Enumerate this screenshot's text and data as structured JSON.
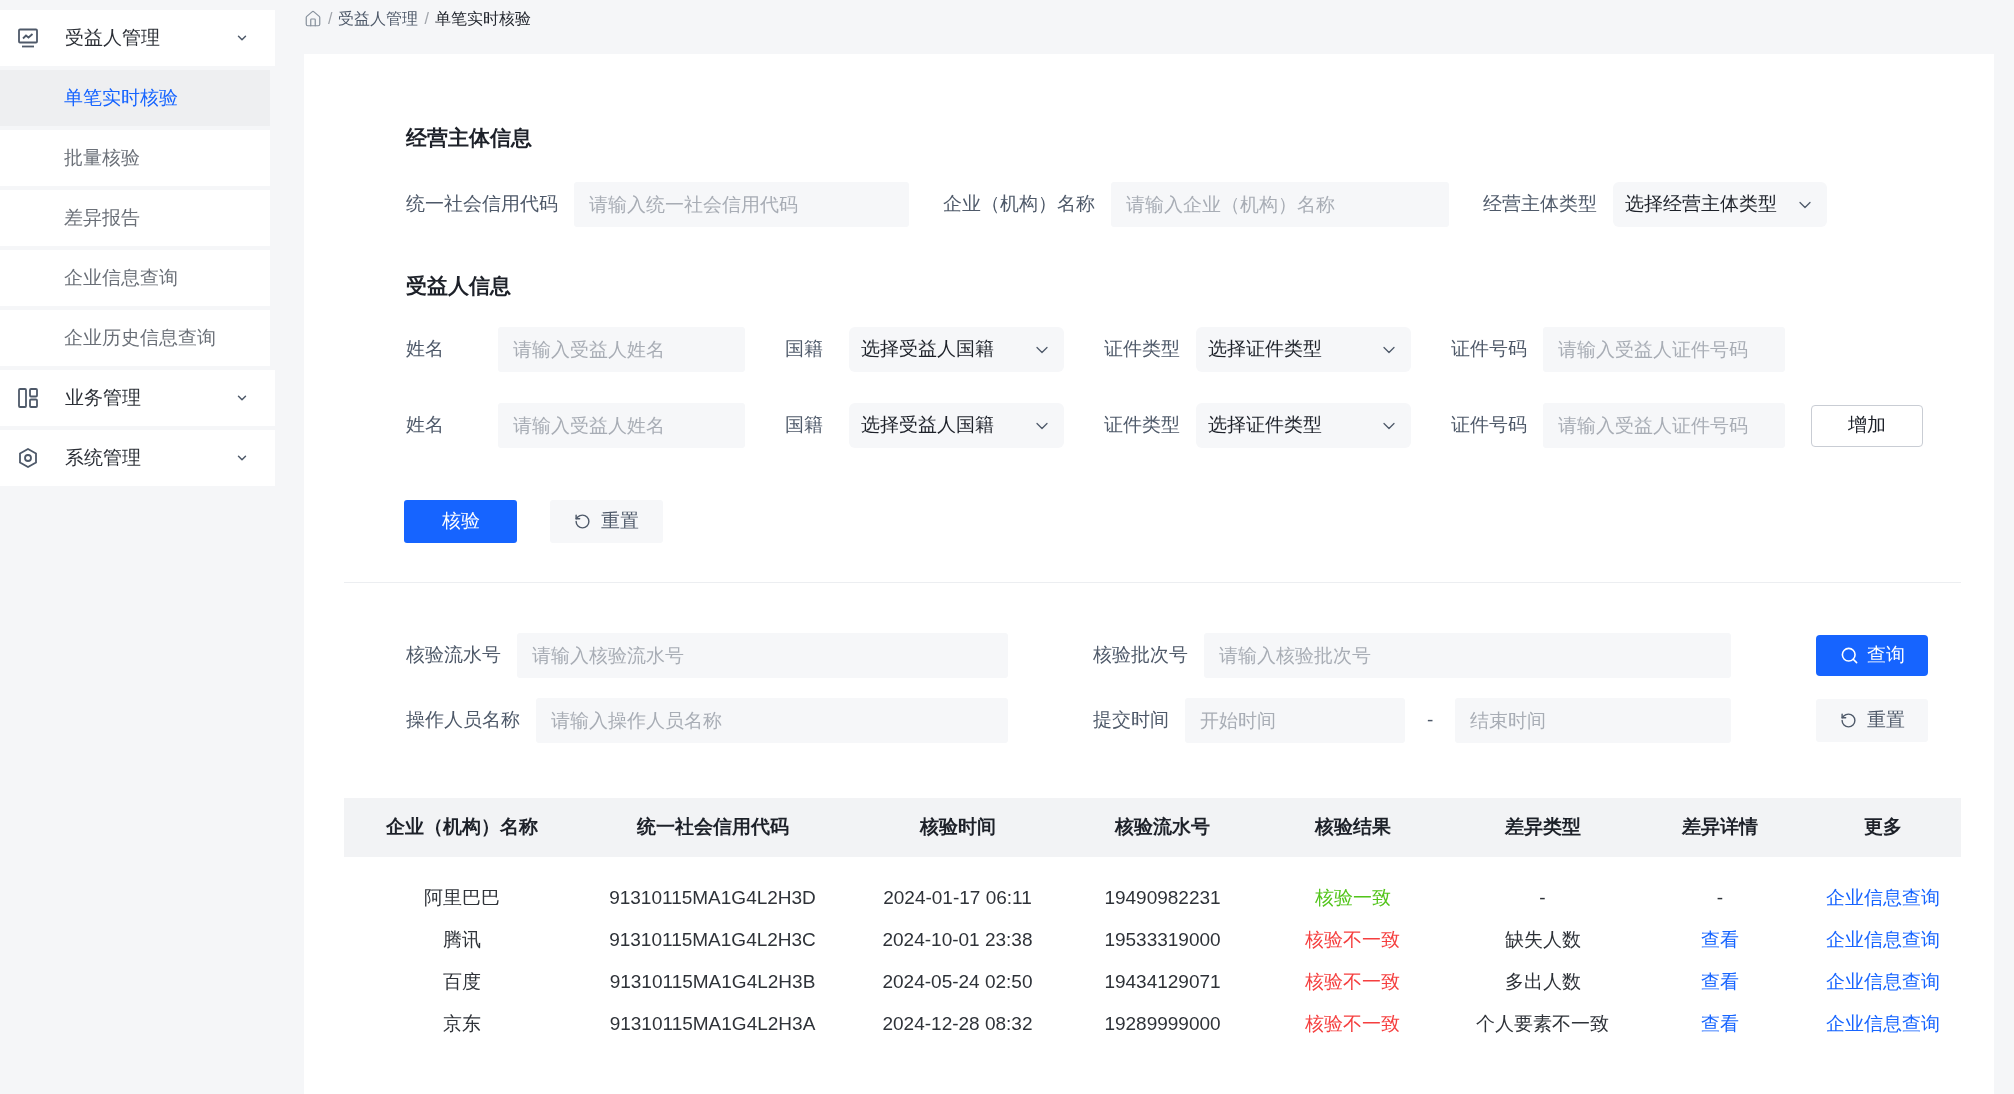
{
  "sidebar": {
    "groups": [
      {
        "label": "受益人管理",
        "children": [
          {
            "label": "单笔实时核验",
            "selected": true
          },
          {
            "label": "批量核验",
            "selected": false
          },
          {
            "label": "差异报告",
            "selected": false
          },
          {
            "label": "企业信息查询",
            "selected": false
          },
          {
            "label": "企业历史信息查询",
            "selected": false
          }
        ]
      },
      {
        "label": "业务管理"
      },
      {
        "label": "系统管理"
      }
    ]
  },
  "breadcrumb": {
    "separator": "/",
    "items": [
      "受益人管理",
      "单笔实时核验"
    ]
  },
  "entity_section": {
    "title": "经营主体信息",
    "fields": [
      {
        "kind": "input",
        "label": "统一社会信用代码",
        "placeholder": "请输入统一社会信用代码"
      },
      {
        "kind": "input",
        "label": "企业（机构）名称",
        "placeholder": "请输入企业（机构）名称"
      },
      {
        "kind": "select",
        "label": "经营主体类型",
        "value": "选择经营主体类型"
      }
    ]
  },
  "beneficiary_section": {
    "title": "受益人信息",
    "rows": [
      {
        "fields": [
          {
            "kind": "input",
            "label": "姓名",
            "placeholder": "请输入受益人姓名"
          },
          {
            "kind": "select",
            "label": "国籍",
            "value": "选择受益人国籍"
          },
          {
            "kind": "select",
            "label": "证件类型",
            "value": "选择证件类型"
          },
          {
            "kind": "input",
            "label": "证件号码",
            "placeholder": "请输入受益人证件号码"
          }
        ]
      },
      {
        "fields": [
          {
            "kind": "input",
            "label": "姓名",
            "placeholder": "请输入受益人姓名"
          },
          {
            "kind": "select",
            "label": "国籍",
            "value": "选择受益人国籍"
          },
          {
            "kind": "select",
            "label": "证件类型",
            "value": "选择证件类型"
          },
          {
            "kind": "input",
            "label": "证件号码",
            "placeholder": "请输入受益人证件号码"
          }
        ],
        "add_button": "增加"
      }
    ]
  },
  "form_actions": [
    {
      "kind": "primary",
      "label": "核验"
    },
    {
      "kind": "reset",
      "label": "重置"
    }
  ],
  "search": {
    "cells": [
      {
        "kind": "input",
        "label": "核验流水号",
        "placeholder": "请输入核验流水号"
      },
      {
        "kind": "input",
        "label": "核验批次号",
        "placeholder": "请输入核验批次号"
      },
      {
        "kind": "search",
        "label": "查询"
      },
      {
        "kind": "input",
        "label": "操作人员名称",
        "placeholder": "请输入操作人员名称"
      },
      {
        "kind": "range",
        "label": "提交时间",
        "inputs": [
          {
            "placeholder": "开始时间"
          },
          {
            "placeholder": "结束时间"
          }
        ],
        "separator": "-"
      },
      {
        "kind": "reset",
        "label": "重置"
      }
    ]
  },
  "table": {
    "columns": [
      "企业（机构）名称",
      "统一社会信用代码",
      "核验时间",
      "核验流水号",
      "核验结果",
      "差异类型",
      "差异详情",
      "更多"
    ],
    "rows": [
      {
        "name": "阿里巴巴",
        "credit_code": "91310115MA1G4L2H3D",
        "time": "2024-01-17 06:11",
        "serial": "19490982231",
        "result": {
          "text": "核验一致",
          "color": "#52c41a"
        },
        "diff_type": "-",
        "detail": {
          "kind": "text",
          "text": "-"
        },
        "more": "企业信息查询"
      },
      {
        "name": "腾讯",
        "credit_code": "91310115MA1G4L2H3C",
        "time": "2024-10-01 23:38",
        "serial": "19533319000",
        "result": {
          "text": "核验不一致",
          "color": "#f53f3f"
        },
        "diff_type": "缺失人数",
        "detail": {
          "kind": "link",
          "text": "查看"
        },
        "more": "企业信息查询"
      },
      {
        "name": "百度",
        "credit_code": "91310115MA1G4L2H3B",
        "time": "2024-05-24 02:50",
        "serial": "19434129071",
        "result": {
          "text": "核验不一致",
          "color": "#f53f3f"
        },
        "diff_type": "多出人数",
        "detail": {
          "kind": "link",
          "text": "查看"
        },
        "more": "企业信息查询"
      },
      {
        "name": "京东",
        "credit_code": "91310115MA1G4L2H3A",
        "time": "2024-12-28 08:32",
        "serial": "19289999000",
        "result": {
          "text": "核验不一致",
          "color": "#f53f3f"
        },
        "diff_type": "个人要素不一致",
        "detail": {
          "kind": "link",
          "text": "查看"
        },
        "more": "企业信息查询"
      }
    ]
  }
}
